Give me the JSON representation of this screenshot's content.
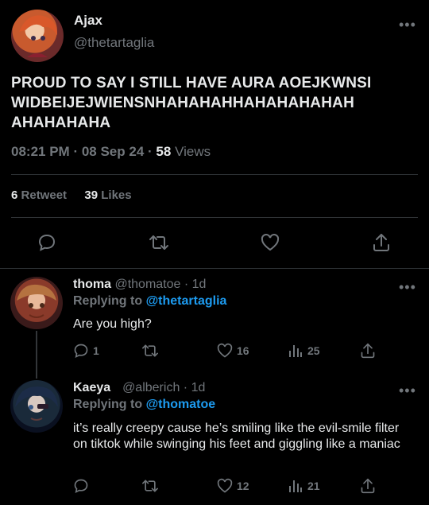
{
  "main_tweet": {
    "author_name": "Ajax",
    "author_handle": "@thetartaglia",
    "text": "PROUD TO SAY I STILL HAVE AURA AOEJKWNSI WIDBEIJEJWIENSNHAHAHAHHAHAHAHAHAH AHAHAHAHA",
    "time": "08:21 PM",
    "date": "08 Sep 24",
    "views_count": "58",
    "views_label": "Views",
    "retweet_count": "6",
    "retweet_label": "Retweet",
    "likes_count": "39",
    "likes_label": "Likes"
  },
  "replies": [
    {
      "author_name": "thoma",
      "author_handle": "@thomatoe",
      "age": "1d",
      "replying_prefix": "Replying to",
      "replying_handle": "@thetartaglia",
      "text": "Are you high?",
      "reply_count": "1",
      "retweet_count": "",
      "like_count": "16",
      "view_count": "25"
    },
    {
      "author_name": "Kaeya",
      "author_handle": "@alberich",
      "age": "1d",
      "replying_prefix": "Replying to",
      "replying_handle": "@thomatoe",
      "text": "it’s really creepy cause he’s smiling like the evil-smile filter on tiktok while swinging his feet and giggling like a maniac",
      "reply_count": "",
      "retweet_count": "",
      "like_count": "12",
      "view_count": "21"
    }
  ],
  "colors": {
    "background": "#000000",
    "text": "#e7e9ea",
    "muted": "#71767b",
    "link": "#1d9bf0",
    "divider": "#2f3336"
  },
  "icons": [
    "more-icon",
    "reply-icon",
    "retweet-icon",
    "like-icon",
    "share-icon",
    "views-icon"
  ]
}
